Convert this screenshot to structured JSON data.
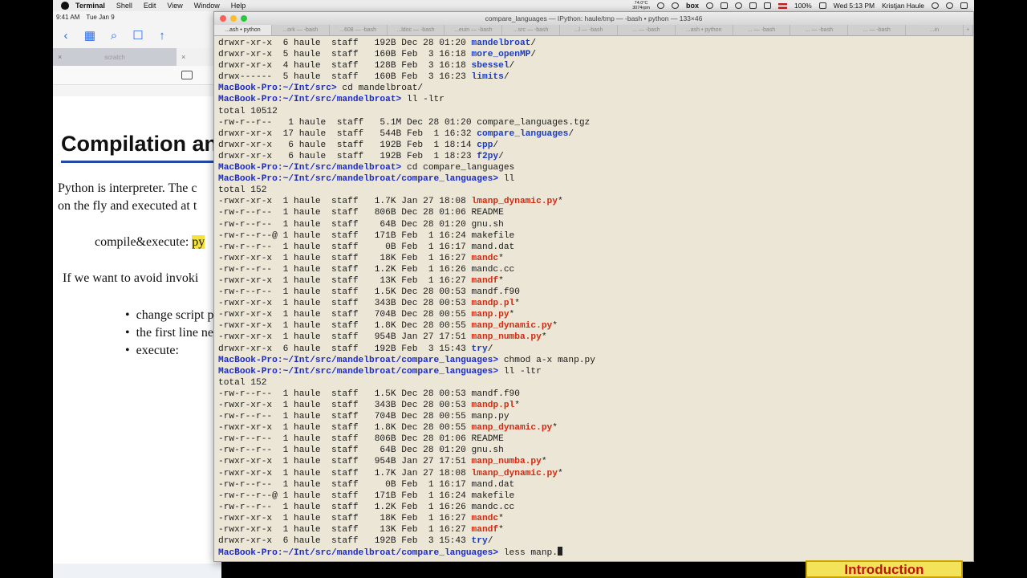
{
  "menubar": {
    "app_name": "Terminal",
    "items": [
      "Shell",
      "Edit",
      "View",
      "Window",
      "Help"
    ],
    "temp_line1": "74.0°C",
    "temp_line2": "3074rpm",
    "box_label": "box",
    "battery": "100%",
    "clock": "Wed 5:13 PM",
    "user": "Kristjan Haule"
  },
  "ipad": {
    "time": "9:41 AM",
    "date": "Tue Jan 9",
    "tab_label": "scratch",
    "slide": {
      "heading": "Compilation and",
      "para1_line1": "Python is interpreter. The c",
      "para1_line2": "on the fly and executed at t",
      "compile_label": "compile&execute: ",
      "compile_highlight": "py",
      "para2": "If we want to avoid invoki",
      "bullets": [
        "change script pe",
        "the first line nee",
        "execute:"
      ]
    }
  },
  "terminal": {
    "title": "compare_languages — IPython: haule/tmp — -bash • python — 133×46",
    "tabs": [
      "...ash • python",
      "...ork — -bash",
      "...608 — -bash",
      "...ldoc — -bash",
      "...euin — -bash",
      "...src — -bash",
      "...l — -bash",
      "... — -bash",
      "...ash • python",
      "... — -bash",
      "... — -bash",
      "... — -bash",
      "...in"
    ],
    "lines": [
      {
        "kind": "ls",
        "text": "drwxr-xr-x  6 haule  staff   192B Dec 28 01:20 ",
        "file": "mandelbroat",
        "suffix": "/",
        "style": "dir"
      },
      {
        "kind": "ls",
        "text": "drwxr-xr-x  5 haule  staff   160B Feb  3 16:18 ",
        "file": "more_openMP",
        "suffix": "/",
        "style": "dir"
      },
      {
        "kind": "ls",
        "text": "drwxr-xr-x  4 haule  staff   128B Feb  3 16:18 ",
        "file": "sbessel",
        "suffix": "/",
        "style": "dir"
      },
      {
        "kind": "ls",
        "text": "drwx------  5 haule  staff   160B Feb  3 16:23 ",
        "file": "limits",
        "suffix": "/",
        "style": "dir"
      },
      {
        "kind": "prompt",
        "prompt": "MacBook-Pro:~/Int/src> ",
        "cmd": "cd mandelbroat/"
      },
      {
        "kind": "prompt",
        "prompt": "MacBook-Pro:~/Int/src/mandelbroat> ",
        "cmd": "ll -ltr"
      },
      {
        "kind": "plain",
        "text": "total 10512"
      },
      {
        "kind": "ls",
        "text": "-rw-r--r--   1 haule  staff   5.1M Dec 28 01:20 ",
        "file": "compare_languages.tgz",
        "suffix": "",
        "style": "plain"
      },
      {
        "kind": "ls",
        "text": "drwxr-xr-x  17 haule  staff   544B Feb  1 16:32 ",
        "file": "compare_languages",
        "suffix": "/",
        "style": "dir"
      },
      {
        "kind": "ls",
        "text": "drwxr-xr-x   6 haule  staff   192B Feb  1 18:14 ",
        "file": "cpp",
        "suffix": "/",
        "style": "dir"
      },
      {
        "kind": "ls",
        "text": "drwxr-xr-x   6 haule  staff   192B Feb  1 18:23 ",
        "file": "f2py",
        "suffix": "/",
        "style": "dir"
      },
      {
        "kind": "prompt",
        "prompt": "MacBook-Pro:~/Int/src/mandelbroat> ",
        "cmd": "cd compare_languages"
      },
      {
        "kind": "prompt",
        "prompt": "MacBook-Pro:~/Int/src/mandelbroat/compare_languages> ",
        "cmd": "ll"
      },
      {
        "kind": "plain",
        "text": "total 152"
      },
      {
        "kind": "ls",
        "text": "-rwxr-xr-x  1 haule  staff   1.7K Jan 27 18:08 ",
        "file": "lmanp_dynamic.py",
        "suffix": "*",
        "style": "exe"
      },
      {
        "kind": "ls",
        "text": "-rw-r--r--  1 haule  staff   806B Dec 28 01:06 ",
        "file": "README",
        "suffix": "",
        "style": "plain"
      },
      {
        "kind": "ls",
        "text": "-rw-r--r--  1 haule  staff    64B Dec 28 01:20 ",
        "file": "gnu.sh",
        "suffix": "",
        "style": "plain"
      },
      {
        "kind": "ls",
        "text": "-rw-r--r--@ 1 haule  staff   171B Feb  1 16:24 ",
        "file": "makefile",
        "suffix": "",
        "style": "plain"
      },
      {
        "kind": "ls",
        "text": "-rw-r--r--  1 haule  staff     0B Feb  1 16:17 ",
        "file": "mand.dat",
        "suffix": "",
        "style": "plain"
      },
      {
        "kind": "ls",
        "text": "-rwxr-xr-x  1 haule  staff    18K Feb  1 16:27 ",
        "file": "mandc",
        "suffix": "*",
        "style": "exe"
      },
      {
        "kind": "ls",
        "text": "-rw-r--r--  1 haule  staff   1.2K Feb  1 16:26 ",
        "file": "mandc.cc",
        "suffix": "",
        "style": "plain"
      },
      {
        "kind": "ls",
        "text": "-rwxr-xr-x  1 haule  staff    13K Feb  1 16:27 ",
        "file": "mandf",
        "suffix": "*",
        "style": "exe"
      },
      {
        "kind": "ls",
        "text": "-rw-r--r--  1 haule  staff   1.5K Dec 28 00:53 ",
        "file": "mandf.f90",
        "suffix": "",
        "style": "plain"
      },
      {
        "kind": "ls",
        "text": "-rwxr-xr-x  1 haule  staff   343B Dec 28 00:53 ",
        "file": "mandp.pl",
        "suffix": "*",
        "style": "exe"
      },
      {
        "kind": "ls",
        "text": "-rwxr-xr-x  1 haule  staff   704B Dec 28 00:55 ",
        "file": "manp.py",
        "suffix": "*",
        "style": "exe"
      },
      {
        "kind": "ls",
        "text": "-rwxr-xr-x  1 haule  staff   1.8K Dec 28 00:55 ",
        "file": "manp_dynamic.py",
        "suffix": "*",
        "style": "exe"
      },
      {
        "kind": "ls",
        "text": "-rwxr-xr-x  1 haule  staff   954B Jan 27 17:51 ",
        "file": "manp_numba.py",
        "suffix": "*",
        "style": "exe"
      },
      {
        "kind": "ls",
        "text": "drwxr-xr-x  6 haule  staff   192B Feb  3 15:43 ",
        "file": "try",
        "suffix": "/",
        "style": "dir"
      },
      {
        "kind": "prompt",
        "prompt": "MacBook-Pro:~/Int/src/mandelbroat/compare_languages> ",
        "cmd": "chmod a-x manp.py"
      },
      {
        "kind": "prompt",
        "prompt": "MacBook-Pro:~/Int/src/mandelbroat/compare_languages> ",
        "cmd": "ll -ltr"
      },
      {
        "kind": "plain",
        "text": "total 152"
      },
      {
        "kind": "ls",
        "text": "-rw-r--r--  1 haule  staff   1.5K Dec 28 00:53 ",
        "file": "mandf.f90",
        "suffix": "",
        "style": "plain"
      },
      {
        "kind": "ls",
        "text": "-rwxr-xr-x  1 haule  staff   343B Dec 28 00:53 ",
        "file": "mandp.pl",
        "suffix": "*",
        "style": "exe"
      },
      {
        "kind": "ls",
        "text": "-rw-r--r--  1 haule  staff   704B Dec 28 00:55 ",
        "file": "manp.py",
        "suffix": "",
        "style": "plain"
      },
      {
        "kind": "ls",
        "text": "-rwxr-xr-x  1 haule  staff   1.8K Dec 28 00:55 ",
        "file": "manp_dynamic.py",
        "suffix": "*",
        "style": "exe"
      },
      {
        "kind": "ls",
        "text": "-rw-r--r--  1 haule  staff   806B Dec 28 01:06 ",
        "file": "README",
        "suffix": "",
        "style": "plain"
      },
      {
        "kind": "ls",
        "text": "-rw-r--r--  1 haule  staff    64B Dec 28 01:20 ",
        "file": "gnu.sh",
        "suffix": "",
        "style": "plain"
      },
      {
        "kind": "ls",
        "text": "-rwxr-xr-x  1 haule  staff   954B Jan 27 17:51 ",
        "file": "manp_numba.py",
        "suffix": "*",
        "style": "exe"
      },
      {
        "kind": "ls",
        "text": "-rwxr-xr-x  1 haule  staff   1.7K Jan 27 18:08 ",
        "file": "lmanp_dynamic.py",
        "suffix": "*",
        "style": "exe"
      },
      {
        "kind": "ls",
        "text": "-rw-r--r--  1 haule  staff     0B Feb  1 16:17 ",
        "file": "mand.dat",
        "suffix": "",
        "style": "plain"
      },
      {
        "kind": "ls",
        "text": "-rw-r--r--@ 1 haule  staff   171B Feb  1 16:24 ",
        "file": "makefile",
        "suffix": "",
        "style": "plain"
      },
      {
        "kind": "ls",
        "text": "-rw-r--r--  1 haule  staff   1.2K Feb  1 16:26 ",
        "file": "mandc.cc",
        "suffix": "",
        "style": "plain"
      },
      {
        "kind": "ls",
        "text": "-rwxr-xr-x  1 haule  staff    18K Feb  1 16:27 ",
        "file": "mandc",
        "suffix": "*",
        "style": "exe"
      },
      {
        "kind": "ls",
        "text": "-rwxr-xr-x  1 haule  staff    13K Feb  1 16:27 ",
        "file": "mandf",
        "suffix": "*",
        "style": "exe"
      },
      {
        "kind": "ls",
        "text": "drwxr-xr-x  6 haule  staff   192B Feb  3 15:43 ",
        "file": "try",
        "suffix": "/",
        "style": "dir"
      },
      {
        "kind": "input",
        "prompt": "MacBook-Pro:~/Int/src/mandelbroat/compare_languages> ",
        "cmd": "less manp."
      }
    ]
  },
  "slide_label": "Introduction"
}
